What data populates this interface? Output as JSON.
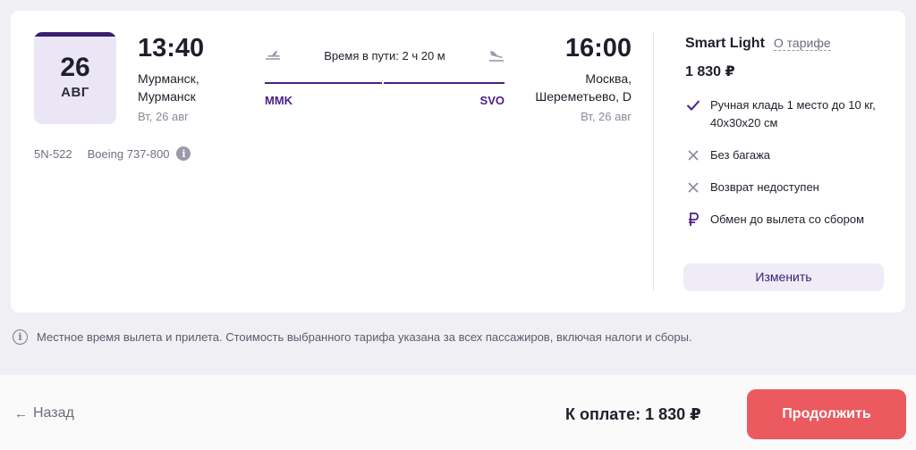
{
  "flight": {
    "date_day": "26",
    "date_month": "АВГ",
    "departure": {
      "time": "13:40",
      "city_line1": "Мурманск,",
      "city_line2": "Мурманск",
      "date": "Вт, 26 авг",
      "code": "MMK"
    },
    "arrival": {
      "time": "16:00",
      "city_line1": "Москва,",
      "city_line2": "Шереметьево, D",
      "date": "Вт, 26 авг",
      "code": "SVO"
    },
    "duration": "Время в пути: 2 ч 20 м",
    "flight_number": "5N-522",
    "aircraft": "Boeing 737-800"
  },
  "tariff": {
    "name": "Smart Light",
    "about_link": "О тарифе",
    "price": "1 830 ₽",
    "features": [
      {
        "icon": "check-icon",
        "text": "Ручная кладь 1 место до 10 кг, 40x30x20 см"
      },
      {
        "icon": "cross-icon",
        "text": "Без багажа"
      },
      {
        "icon": "cross-icon",
        "text": "Возврат недоступен"
      },
      {
        "icon": "ruble-icon",
        "text": "Обмен до вылета со сбором"
      }
    ],
    "change_button": "Изменить"
  },
  "note": "Местное время вылета и прилета. Стоимость выбранного тарифа указана за всех пассажиров, включая налоги и сборы.",
  "footer": {
    "back_label": "Назад",
    "total_label": "К оплате: 1 830 ₽",
    "continue_button": "Продолжить"
  },
  "colors": {
    "accent": "#4a1f8a",
    "primary_button": "#ea5a5e",
    "date_box_bg": "#ebe6f5",
    "background": "#f0f0f4"
  }
}
